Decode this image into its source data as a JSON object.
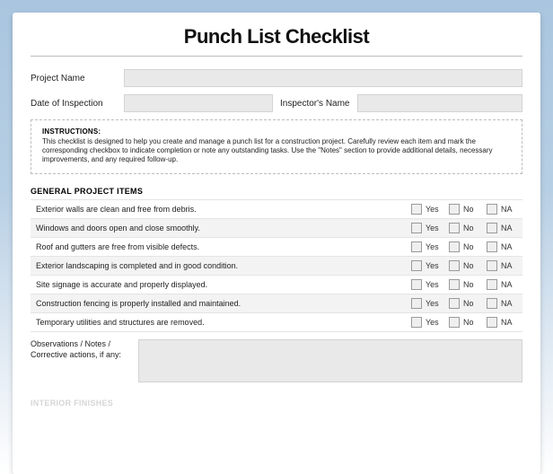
{
  "title": "Punch List Checklist",
  "meta": {
    "project_label": "Project Name",
    "date_label": "Date of Inspection",
    "inspector_label": "Inspector's Name"
  },
  "instructions": {
    "heading": "INSTRUCTIONS:",
    "body": "This checklist is designed to help you create and manage a punch list for a construction project. Carefully review each item and mark the corresponding checkbox to indicate completion or note any outstanding tasks. Use the \"Notes\" section to provide additional details, necessary improvements, and any required follow-up."
  },
  "options": {
    "yes": "Yes",
    "no": "No",
    "na": "NA"
  },
  "section1": {
    "heading": "GENERAL PROJECT ITEMS",
    "items": [
      "Exterior walls are clean and free from debris.",
      "Windows and doors open and close smoothly.",
      "Roof and gutters are free from visible defects.",
      "Exterior landscaping is completed and in good condition.",
      "Site signage is accurate and properly displayed.",
      "Construction fencing is properly installed and maintained.",
      "Temporary utilities and structures are removed."
    ]
  },
  "notes_label": "Observations / Notes / Corrective actions, if any:",
  "section2_heading": "INTERIOR FINISHES"
}
